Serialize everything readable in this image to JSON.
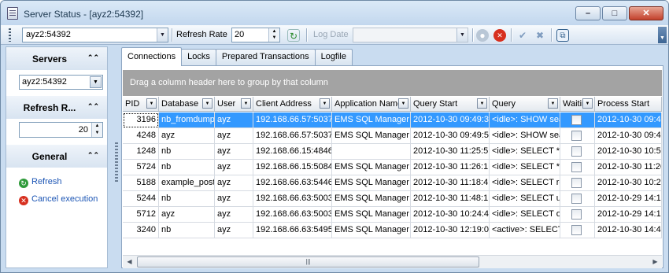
{
  "window": {
    "title": "Server Status - [ayz2:54392]",
    "min": "–",
    "max": "□",
    "close": "✕"
  },
  "toolbar": {
    "server_value": "ayz2:54392",
    "refresh_label": "Refresh Rate",
    "refresh_value": "20",
    "log_date_label": "Log Date",
    "log_date_value": ""
  },
  "left": {
    "servers_title": "Servers",
    "server_value": "ayz2:54392",
    "refresh_title": "Refresh R...",
    "refresh_value": "20",
    "general_title": "General",
    "refresh_link": "Refresh",
    "cancel_link": "Cancel execution"
  },
  "tabs": [
    "Connections",
    "Locks",
    "Prepared Transactions",
    "Logfile"
  ],
  "grid": {
    "group_hint": "Drag a column header here to group by that column",
    "columns": [
      "PID",
      "Database",
      "User",
      "Client Address",
      "Application Name",
      "Query Start",
      "Query",
      "Waiting",
      "Process Start"
    ],
    "rows": [
      {
        "pid": "3196",
        "db": "nb_fromdump",
        "user": "ayz",
        "addr": "192.168.66.57:5037",
        "app": "EMS SQL Manager",
        "qstart": "2012-10-30 09:49:3",
        "query": "<idle>: SHOW search_path",
        "waiting": false,
        "pstart": "2012-10-30 09:49:"
      },
      {
        "pid": "4248",
        "db": "ayz",
        "user": "ayz",
        "addr": "192.168.66.57:5037",
        "app": "EMS SQL Manager",
        "qstart": "2012-10-30 09:49:5",
        "query": "<idle>: SHOW search_path",
        "waiting": false,
        "pstart": "2012-10-30 09:49:"
      },
      {
        "pid": "1248",
        "db": "nb",
        "user": "ayz",
        "addr": "192.168.66.15:4846",
        "app": "",
        "qstart": "2012-10-30 11:25:5",
        "query": "<idle>: SELECT *",
        "waiting": false,
        "pstart": "2012-10-30 10:53"
      },
      {
        "pid": "5724",
        "db": "nb",
        "user": "ayz",
        "addr": "192.168.66.15:5084",
        "app": "EMS SQL Manager",
        "qstart": "2012-10-30 11:26:1",
        "query": "<idle>: SELECT *",
        "waiting": false,
        "pstart": "2012-10-30 11:26"
      },
      {
        "pid": "5188",
        "db": "example_post",
        "user": "ayz",
        "addr": "192.168.66.63:5446",
        "app": "EMS SQL Manager",
        "qstart": "2012-10-30 11:18:4",
        "query": "<idle>: SELECT relname",
        "waiting": false,
        "pstart": "2012-10-30 10:25"
      },
      {
        "pid": "5244",
        "db": "nb",
        "user": "ayz",
        "addr": "192.168.66.63:5003",
        "app": "EMS SQL Manager",
        "qstart": "2012-10-30 11:48:1",
        "query": "<idle>: SELECT u",
        "waiting": false,
        "pstart": "2012-10-29 14:19"
      },
      {
        "pid": "5712",
        "db": "ayz",
        "user": "ayz",
        "addr": "192.168.66.63:5003",
        "app": "EMS SQL Manager",
        "qstart": "2012-10-30 10:24:4",
        "query": "<idle>: SELECT o",
        "waiting": false,
        "pstart": "2012-10-29 14:19"
      },
      {
        "pid": "3240",
        "db": "nb",
        "user": "ayz",
        "addr": "192.168.66.63:5495",
        "app": "EMS SQL Manager",
        "qstart": "2012-10-30 12:19:0",
        "query": "<active>: SELECT",
        "waiting": false,
        "pstart": "2012-10-30 14:48"
      }
    ]
  }
}
